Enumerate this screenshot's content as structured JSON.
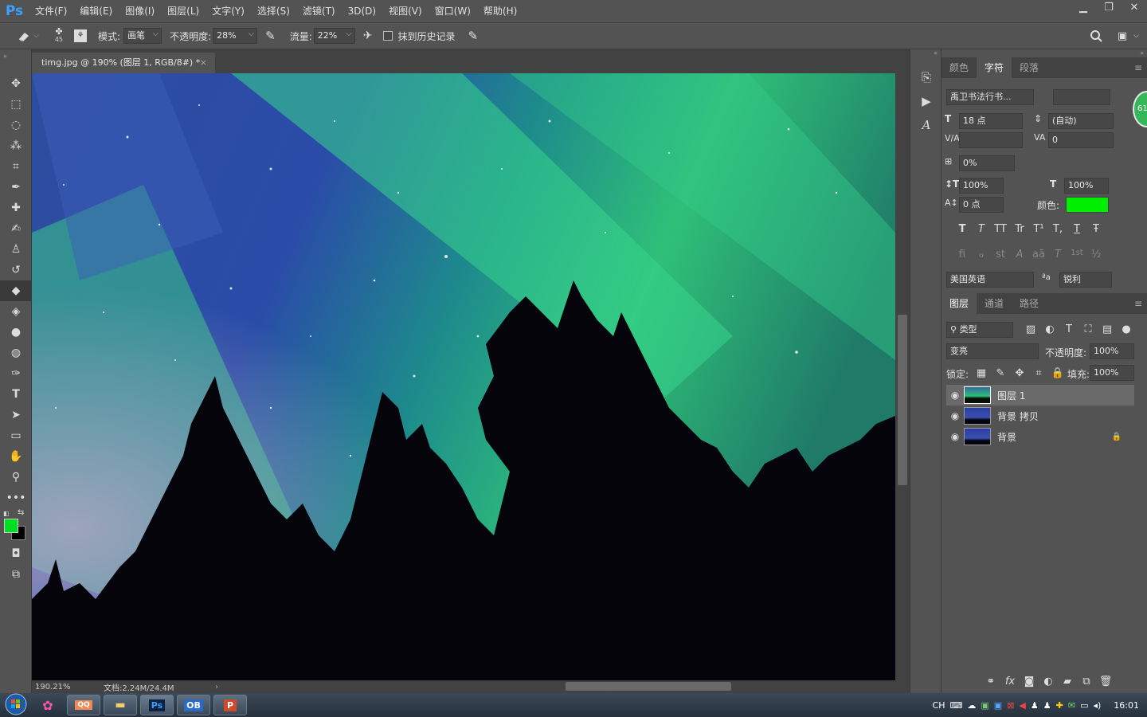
{
  "app": {
    "logo": "Ps"
  },
  "menu": [
    "文件(F)",
    "编辑(E)",
    "图像(I)",
    "图层(L)",
    "文字(Y)",
    "选择(S)",
    "滤镜(T)",
    "3D(D)",
    "视图(V)",
    "窗口(W)",
    "帮助(H)"
  ],
  "window_controls": {
    "minimize": "▁",
    "restore": "❐",
    "close": "✕"
  },
  "options": {
    "brush_size": "45",
    "mode_label": "模式:",
    "mode_value": "画笔",
    "opacity_label": "不透明度:",
    "opacity_value": "28%",
    "flow_label": "流量:",
    "flow_value": "22%",
    "erase_history_label": "抹到历史记录"
  },
  "document": {
    "tab_title": "timg.jpg @ 190% (图层 1, RGB/8#) *",
    "close": "×"
  },
  "status": {
    "zoom": "190.21%",
    "doc_info": "文档:2.24M/24.4M"
  },
  "character_panel": {
    "tabs": [
      "颜色",
      "字符",
      "段落"
    ],
    "active_tab": "字符",
    "font_family": "禹卫书法行书...",
    "font_size": "18 点",
    "leading": "(自动)",
    "kerning": "",
    "tracking": "0",
    "tsume": "0%",
    "vscale": "100%",
    "hscale": "100%",
    "baseline": "0 点",
    "color_label": "颜色:",
    "color_value": "#00ee00",
    "style_glyphs": [
      "T",
      "T",
      "TT",
      "Tr",
      "T¹",
      "T,",
      "T",
      "Ŧ"
    ],
    "opentype_glyphs": [
      "fi",
      "ℴ",
      "st",
      "A",
      "aā",
      "T",
      "1st",
      "½"
    ],
    "language": "美国英语",
    "aa_label": "ªa",
    "antialias": "锐利"
  },
  "layers_panel": {
    "tabs": [
      "图层",
      "通道",
      "路径"
    ],
    "active_tab": "图层",
    "filter": "类型",
    "blend_mode": "变亮",
    "opacity_label": "不透明度:",
    "opacity_value": "100%",
    "lock_label": "锁定:",
    "fill_label": "填充:",
    "fill_value": "100%",
    "layers": [
      {
        "name": "图层 1",
        "selected": true,
        "locked": false
      },
      {
        "name": "背景 拷贝",
        "selected": false,
        "locked": false
      },
      {
        "name": "背景",
        "selected": false,
        "locked": true
      }
    ],
    "bottom_icons": [
      "link-icon",
      "fx-icon",
      "mask-icon",
      "adjustment-icon",
      "group-icon",
      "new-layer-icon",
      "trash-icon"
    ]
  },
  "taskbar": {
    "ime": "CH",
    "clock": "16:01",
    "apps": [
      "QQ",
      "文件夹",
      "Ps",
      "OB",
      "P"
    ]
  },
  "badge": "61",
  "colors": {
    "foreground": "#00dd22",
    "background": "#000000",
    "accent": "#3ba0ff"
  }
}
